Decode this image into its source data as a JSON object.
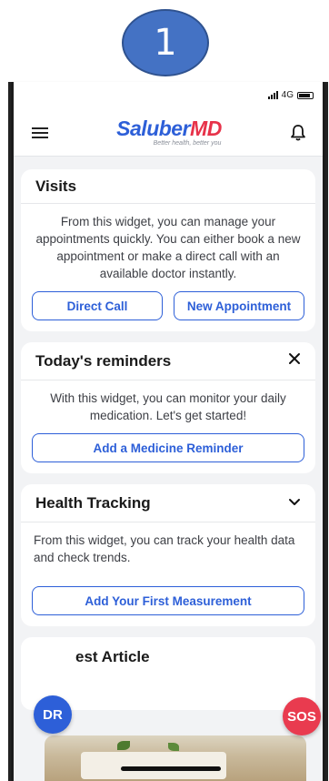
{
  "step_badge": "1",
  "status": {
    "network": "4G"
  },
  "header": {
    "logo_part1": "Saluber",
    "logo_part2": "MD",
    "tagline": "Better health, better you",
    "brand_blue": "#2d5fd8",
    "brand_red": "#e7334a"
  },
  "visits": {
    "title": "Visits",
    "description": "From this widget, you can manage your appointments quickly. You can either book a new appointment or make a direct call with an available doctor instantly.",
    "direct_call": "Direct Call",
    "new_appointment": "New Appointment"
  },
  "reminders": {
    "title": "Today's reminders",
    "description": "With this widget, you can monitor your daily medication. Let's get started!",
    "button": "Add a  Medicine Reminder"
  },
  "health": {
    "title": "Health Tracking",
    "description": "From this widget, you can track your health data and check trends.",
    "button": "Add Your First Measurement"
  },
  "article": {
    "title": "est Article"
  },
  "fabs": {
    "doctor": "DR",
    "sos": "SOS"
  }
}
